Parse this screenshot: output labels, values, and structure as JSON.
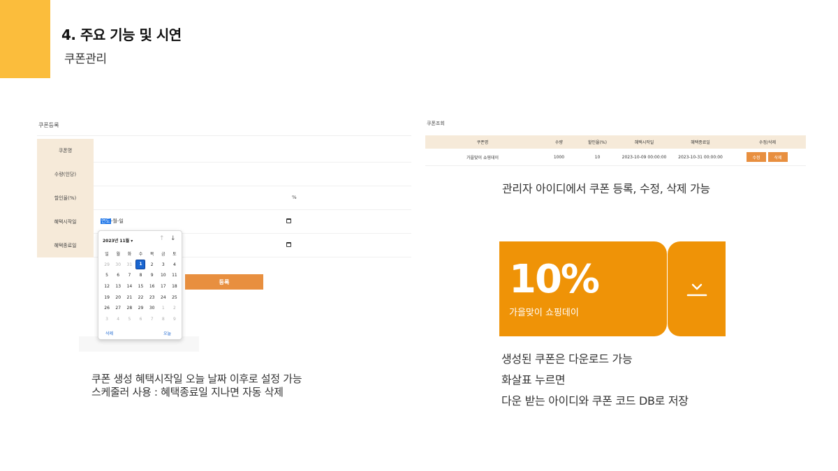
{
  "slide": {
    "title": "4. 주요 기능 및 시연",
    "subtitle": "쿠폰관리"
  },
  "register": {
    "title": "쿠폰등록",
    "fields": [
      {
        "label": "쿠폰명"
      },
      {
        "label": "수량(인당)"
      },
      {
        "label": "할인율(%)",
        "suffix": "%"
      },
      {
        "label": "혜택시작일",
        "placeholder_year": "연도",
        "placeholder_rest": "-월-일"
      },
      {
        "label": "혜택종료일"
      }
    ],
    "submit_label": "등록",
    "datepicker": {
      "month_label": "2023년 11월 ▾",
      "weekdays": [
        "일",
        "월",
        "화",
        "수",
        "목",
        "금",
        "토"
      ],
      "weeks": [
        [
          "29",
          "30",
          "31",
          "1",
          "2",
          "3",
          "4"
        ],
        [
          "5",
          "6",
          "7",
          "8",
          "9",
          "10",
          "11"
        ],
        [
          "12",
          "13",
          "14",
          "15",
          "16",
          "17",
          "18"
        ],
        [
          "19",
          "20",
          "21",
          "22",
          "23",
          "24",
          "25"
        ],
        [
          "26",
          "27",
          "28",
          "29",
          "30",
          "1",
          "2"
        ],
        [
          "3",
          "4",
          "5",
          "6",
          "7",
          "8",
          "9"
        ]
      ],
      "selected_day": "1",
      "clear_label": "삭제",
      "today_label": "오늘"
    }
  },
  "desc_left": {
    "line1": "쿠폰 생성 혜택시작일 오늘 날짜 이후로 설정 가능",
    "line2": "스케줄러 사용 : 혜택종료일 지나면 자동 삭제"
  },
  "list": {
    "title": "쿠폰조회",
    "headers": [
      "쿠폰명",
      "수량",
      "할인율(%)",
      "혜택시작일",
      "혜택종료일",
      "수정/삭제"
    ],
    "rows": [
      {
        "name": "가을맞이 쇼핑데이",
        "quantity": "1000",
        "rate": "10",
        "start": "2023-10-09 00:00:00",
        "end": "2023-10-31 00:00:00",
        "edit_label": "수정",
        "delete_label": "삭제"
      }
    ],
    "description": "관리자 아이디에서 쿠폰 등록, 수정, 삭제 가능"
  },
  "coupon": {
    "rate_text": "10%",
    "name": "가을맞이 쇼핑데이",
    "icon": "download-icon",
    "color": "#ef9307"
  },
  "desc_card": {
    "line1": "생성된 쿠폰은 다운로드 가능",
    "line2": "화살표 누르면",
    "line3": "다운 받는 아이디와 쿠폰 코드 DB로 저장"
  },
  "colors": {
    "accent": "#fbbd3c",
    "label_bg": "#f6ead9",
    "button": "#e88f3f",
    "selected": "#1a66d0"
  }
}
